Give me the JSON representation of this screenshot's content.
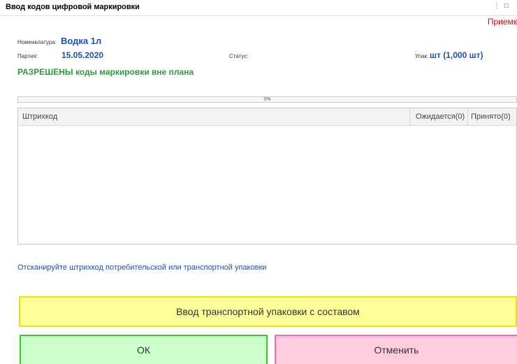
{
  "window": {
    "title": "Ввод кодов цифровой маркировки",
    "controls": [
      "⋮",
      "□"
    ],
    "mode_label": "Приемк"
  },
  "item": {
    "nomenclature_label": "Номенклатура:",
    "nomenclature_value": "Водка 1л",
    "batch_label": "Партия:",
    "batch_value": "15.05.2020",
    "status_label": "Статус:",
    "package_label": "Упак:",
    "package_value": "шт (1,000 шт)"
  },
  "allowed_notice": "РАЗРЕШЕНЫ коды маркировки вне плана",
  "progress": {
    "percent": 0,
    "label": "0%"
  },
  "table": {
    "columns": [
      "Штрихкод",
      "Ожидается(0)",
      "Принято(0)"
    ],
    "rows": []
  },
  "hint": "Отсканируйте штрихкод потребительской или транспортной упаковки",
  "buttons": {
    "transport": "Ввод транспортной упаковки с составом",
    "ok": "ОК",
    "cancel": "Отменить"
  },
  "colors": {
    "accent_blue": "#1f4fb4",
    "notice_green": "#2e9a3c",
    "mode_red": "#e00000",
    "transport_bg": "#ffff99",
    "ok_bg": "#ccffcc",
    "cancel_bg": "#ffcce0"
  }
}
